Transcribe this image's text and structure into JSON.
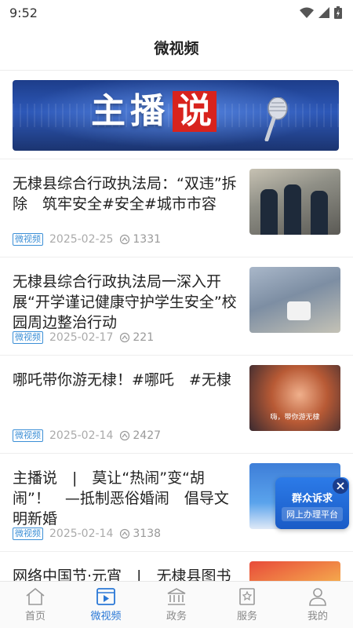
{
  "status_bar": {
    "time": "9:52"
  },
  "header": {
    "title": "微视频"
  },
  "banner": {
    "text_white": "主播",
    "text_red": "说"
  },
  "feed": [
    {
      "title": "无棣县综合行政执法局：“双违”拆除　筑牢安全#安全#城市市容",
      "tag": "微视频",
      "date": "2025-02-25",
      "views": "1331"
    },
    {
      "title": "无棣县综合行政执法局一深入开展“开学谨记健康守护学生安全”校园周边整治行动",
      "tag": "微视频",
      "date": "2025-02-17",
      "views": "221"
    },
    {
      "title": "哪吒带你游无棣！#哪吒　#无棣",
      "tag": "微视频",
      "date": "2025-02-14",
      "views": "2427",
      "thumb_caption": "嗨，带你游无棣"
    },
    {
      "title": "主播说　|　莫让“热闹”变“胡闹”！　—抵制恶俗婚闹　倡导文明新婚",
      "tag": "微视频",
      "date": "2025-02-14",
      "views": "3138"
    },
    {
      "title": "网络中国节·元宵　|　无棣县图书馆",
      "tag": "微视频",
      "date": "",
      "views": ""
    }
  ],
  "float_badge": {
    "line1": "群众诉求",
    "line2": "网上办理平台"
  },
  "bottom_nav": [
    {
      "label": "首页",
      "icon": "home-icon",
      "active": false
    },
    {
      "label": "微视频",
      "icon": "video-icon",
      "active": true
    },
    {
      "label": "政务",
      "icon": "government-icon",
      "active": false
    },
    {
      "label": "服务",
      "icon": "service-icon",
      "active": false
    },
    {
      "label": "我的",
      "icon": "profile-icon",
      "active": false
    }
  ],
  "colors": {
    "accent": "#2a78d6",
    "tag": "#3c8fd6",
    "banner_red": "#d8231d",
    "banner_blue": "#1d3d8a"
  }
}
